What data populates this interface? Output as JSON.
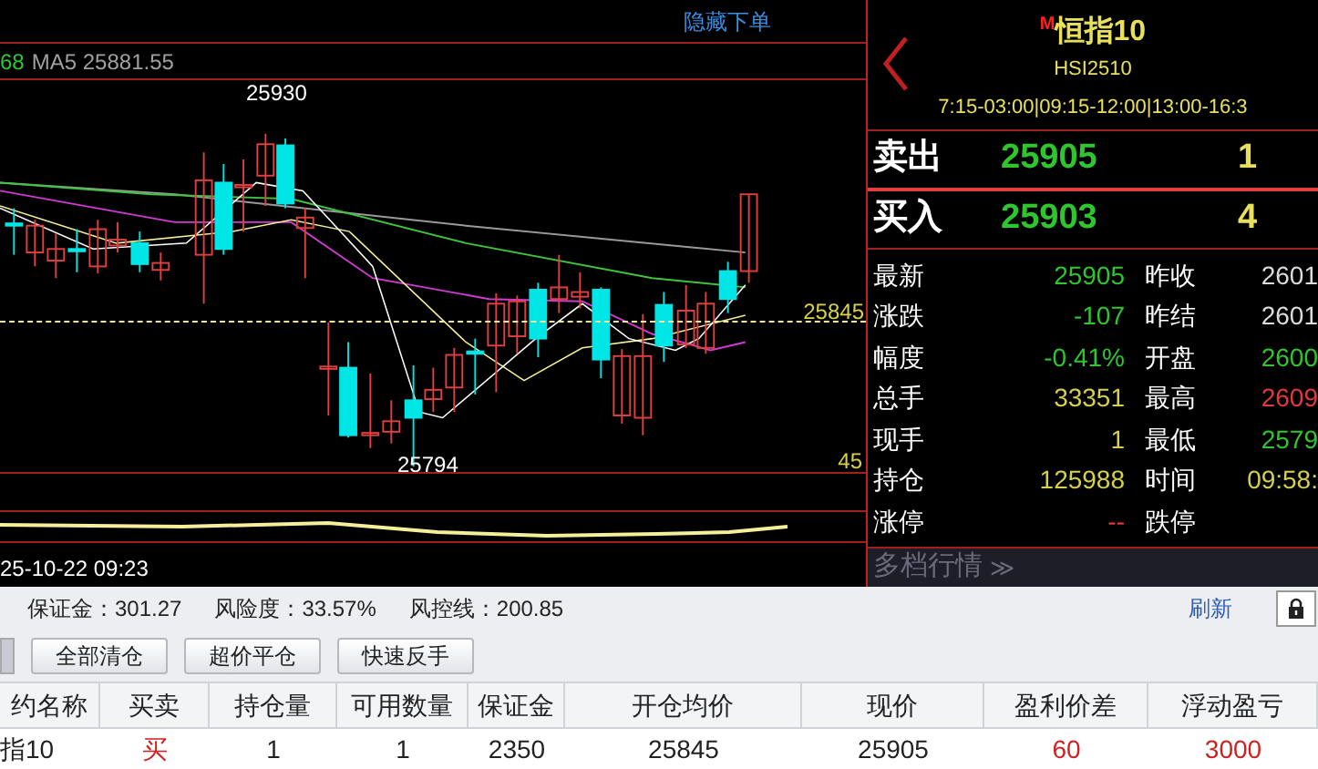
{
  "chart": {
    "hide_order_link": "隐藏下单",
    "ma_prefix": "68",
    "ma_label": "MA5 25881.55",
    "high_label": "25930",
    "low_label": "25794",
    "price_line_label": "25845",
    "axis_label": "45",
    "time_label": "25-10-22 09:23"
  },
  "quote": {
    "badge": "M",
    "title": "恒指10",
    "code": "HSI2510",
    "sessions": "7:15-03:00|09:15-12:00|13:00-16:3",
    "sell": {
      "label": "卖出",
      "price": "25905",
      "volume": "1"
    },
    "buy": {
      "label": "买入",
      "price": "25903",
      "volume": "4"
    },
    "stats": [
      {
        "left": {
          "label": "最新",
          "value": "25905",
          "color": "#2fc52f"
        },
        "right": {
          "label": "昨收",
          "value": "2601",
          "color": "#dcdcdc"
        }
      },
      {
        "left": {
          "label": "涨跌",
          "value": "-107",
          "color": "#2fc52f"
        },
        "right": {
          "label": "昨结",
          "value": "2601",
          "color": "#dcdcdc"
        }
      },
      {
        "left": {
          "label": "幅度",
          "value": "-0.41%",
          "color": "#2fc52f"
        },
        "right": {
          "label": "开盘",
          "value": "2600",
          "color": "#2fc52f"
        }
      },
      {
        "left": {
          "label": "总手",
          "value": "33351",
          "color": "#d6d04a"
        },
        "right": {
          "label": "最高",
          "value": "2609",
          "color": "#e03a3a"
        }
      },
      {
        "left": {
          "label": "现手",
          "value": "1",
          "color": "#d6d04a"
        },
        "right": {
          "label": "最低",
          "value": "2579",
          "color": "#2fc52f"
        }
      },
      {
        "left": {
          "label": "持仓",
          "value": "125988",
          "color": "#d6d04a"
        },
        "right": {
          "label": "时间",
          "value": "09:58:",
          "color": "#d6d04a"
        }
      },
      {
        "left": {
          "label": "涨停",
          "value": "--",
          "color": "#e03a3a"
        },
        "right": {
          "label": "跌停"
        }
      }
    ],
    "depth_toggle": "多档行情",
    "depth_icon": "≫"
  },
  "account": {
    "items": [
      "保证金：301.27",
      "风险度：33.57%",
      "风控线：200.85"
    ],
    "refresh": "刷新"
  },
  "actions": [
    "全部清仓",
    "超价平仓",
    "快速反手"
  ],
  "table": {
    "columns": [
      "约名称",
      "买卖",
      "持仓量",
      "可用数量",
      "保证金",
      "开仓均价",
      "现价",
      "盈利价差",
      "浮动盈亏"
    ],
    "rows": [
      {
        "cells": [
          {
            "text": "指10",
            "color": "#222222"
          },
          {
            "text": "买",
            "color": "#d02020"
          },
          {
            "text": "1",
            "color": "#222222"
          },
          {
            "text": "1",
            "color": "#222222"
          },
          {
            "text": "2350",
            "color": "#222222"
          },
          {
            "text": "25845",
            "color": "#222222"
          },
          {
            "text": "25905",
            "color": "#222222"
          },
          {
            "text": "60",
            "color": "#d02020"
          },
          {
            "text": "3000",
            "color": "#d02020"
          }
        ]
      }
    ]
  }
}
